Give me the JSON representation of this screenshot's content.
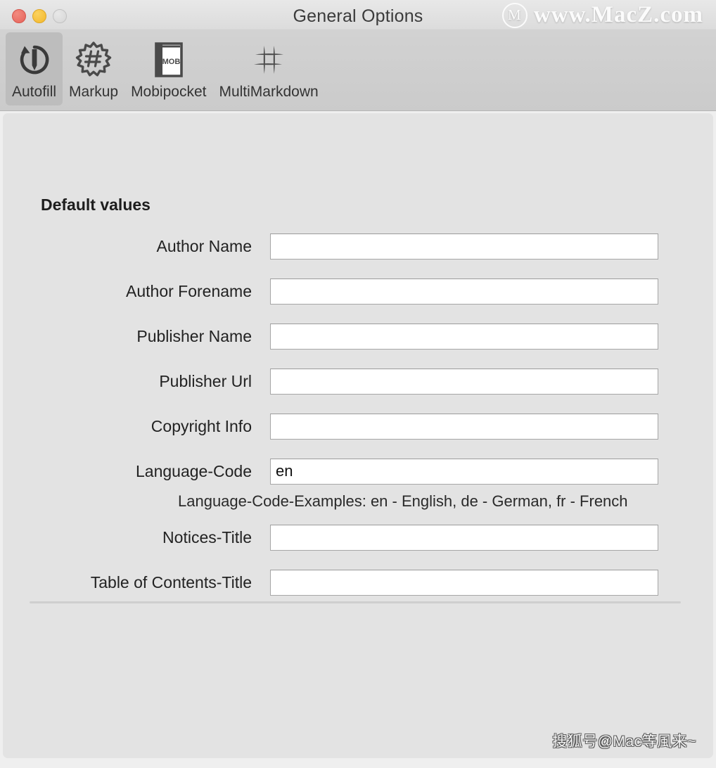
{
  "window": {
    "title": "General Options",
    "traffic_lights": [
      {
        "name": "close",
        "color": "#ee6a5f"
      },
      {
        "name": "minimize",
        "color": "#f5bd4f"
      },
      {
        "name": "zoom",
        "color": "#dcdcdc"
      }
    ]
  },
  "watermarks": {
    "top": "www.MacZ.com",
    "top_logo_letter": "M",
    "bottom": "搜狐号@Mac等風来~"
  },
  "toolbar": {
    "tabs": [
      {
        "label": "Autofill",
        "icon": "autofill-icon",
        "selected": true
      },
      {
        "label": "Markup",
        "icon": "markup-icon",
        "selected": false
      },
      {
        "label": "Mobipocket",
        "icon": "mobipocket-icon",
        "selected": false
      },
      {
        "label": "MultiMarkdown",
        "icon": "multimarkdown-icon",
        "selected": false
      }
    ],
    "mobipocket_icon_text": "MOBI"
  },
  "content": {
    "section_title": "Default values",
    "fields": [
      {
        "label": "Author Name",
        "value": "",
        "placeholder": ""
      },
      {
        "label": "Author Forename",
        "value": "",
        "placeholder": ""
      },
      {
        "label": "Publisher Name",
        "value": "",
        "placeholder": ""
      },
      {
        "label": "Publisher Url",
        "value": "",
        "placeholder": ""
      },
      {
        "label": "Copyright Info",
        "value": "",
        "placeholder": ""
      },
      {
        "label": "Language-Code",
        "value": "en",
        "placeholder": ""
      },
      {
        "label": "Notices-Title",
        "value": "",
        "placeholder": ""
      },
      {
        "label": "Table of Contents-Title",
        "value": "",
        "placeholder": ""
      }
    ],
    "language_hint": "Language-Code-Examples: en - English, de - German, fr - French"
  },
  "colors": {
    "toolbar_bg": "#cfcfcf",
    "content_bg": "#e3e3e3",
    "selected_tab_bg": "#bdbdbd",
    "field_border": "#a6a6a6",
    "text": "#222222"
  }
}
